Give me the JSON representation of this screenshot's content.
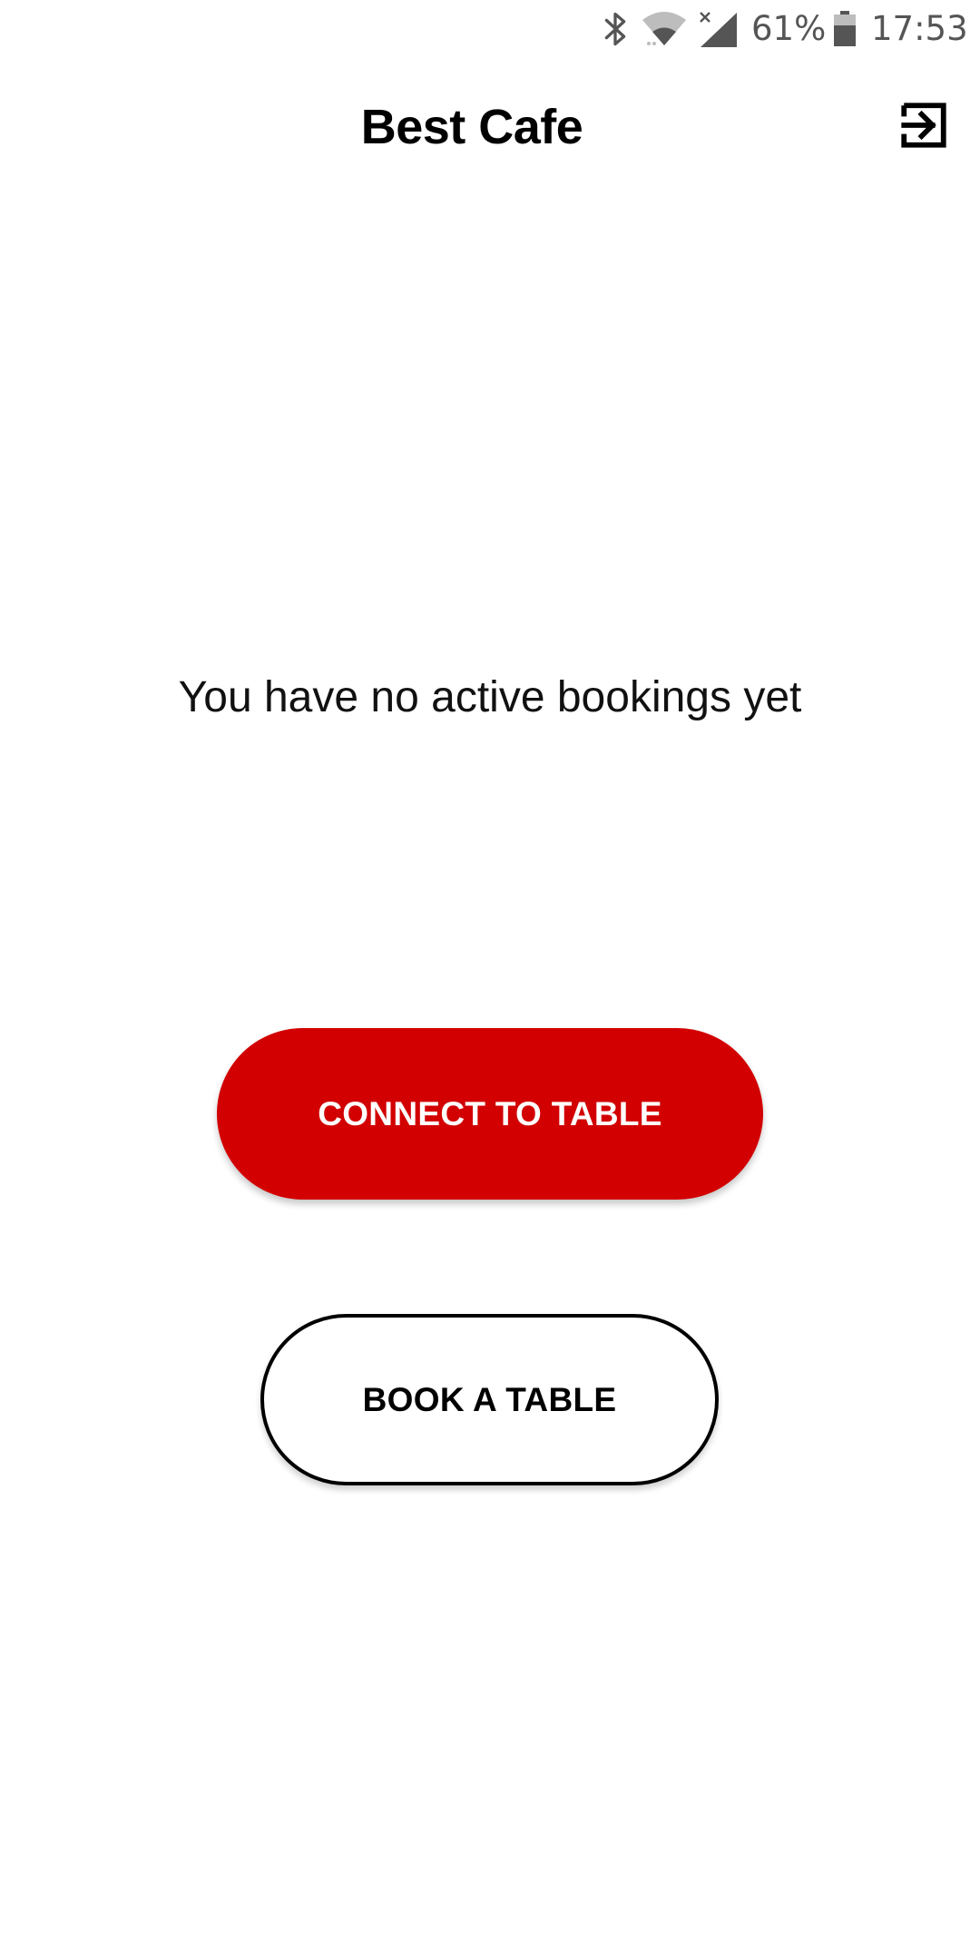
{
  "status_bar": {
    "battery_percent": "61%",
    "time": "17:53",
    "icons": [
      "bluetooth-icon",
      "wifi-icon",
      "cell-signal-icon",
      "battery-icon"
    ],
    "icon_color": "#555555"
  },
  "app_bar": {
    "title": "Best Cafe",
    "logout_icon": "logout-icon"
  },
  "main": {
    "empty_message": "You have no active bookings yet"
  },
  "actions": {
    "connect_label": "CONNECT TO TABLE",
    "book_label": "BOOK A TABLE"
  },
  "colors": {
    "primary": "#d20000",
    "background": "#ffffff",
    "text": "#000000"
  }
}
